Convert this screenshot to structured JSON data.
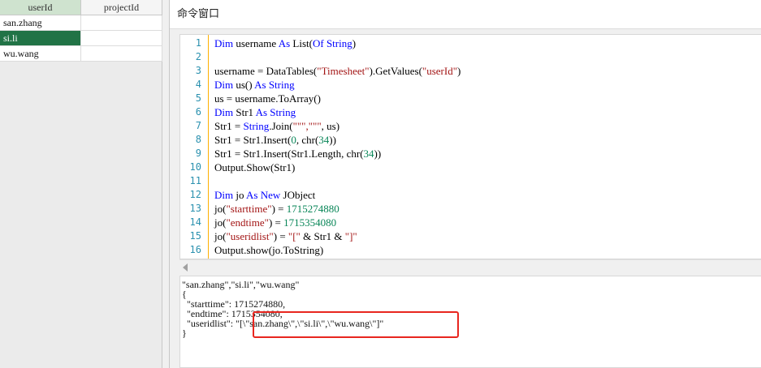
{
  "grid": {
    "columns": [
      "userId",
      "projectId"
    ],
    "rows": [
      {
        "userId": "san.zhang",
        "projectId": ""
      },
      {
        "userId": "si.li",
        "projectId": ""
      },
      {
        "userId": "wu.wang",
        "projectId": ""
      }
    ],
    "selected_header_color": "#cfe3cf",
    "active_cell_color": "#217346"
  },
  "command_window": {
    "title": "命令窗口",
    "line_numbers": [
      "1",
      "2",
      "3",
      "4",
      "5",
      "6",
      "7",
      "8",
      "9",
      "10",
      "11",
      "12",
      "13",
      "14",
      "15",
      "16"
    ],
    "code_lines": [
      [
        {
          "t": "Dim",
          "c": "kw"
        },
        {
          "t": " username "
        },
        {
          "t": "As",
          "c": "kw"
        },
        {
          "t": " List("
        },
        {
          "t": "Of",
          "c": "kw"
        },
        {
          "t": " "
        },
        {
          "t": "String",
          "c": "kw"
        },
        {
          "t": ")"
        }
      ],
      [
        {
          "t": ""
        }
      ],
      [
        {
          "t": "username = DataTables("
        },
        {
          "t": "\"Timesheet\"",
          "c": "str"
        },
        {
          "t": ").GetValues("
        },
        {
          "t": "\"userId\"",
          "c": "str"
        },
        {
          "t": ")"
        }
      ],
      [
        {
          "t": "Dim",
          "c": "kw"
        },
        {
          "t": " us() "
        },
        {
          "t": "As",
          "c": "kw"
        },
        {
          "t": " "
        },
        {
          "t": "String",
          "c": "kw"
        }
      ],
      [
        {
          "t": "us = username.ToArray()"
        }
      ],
      [
        {
          "t": "Dim",
          "c": "kw"
        },
        {
          "t": " Str1 "
        },
        {
          "t": "As",
          "c": "kw"
        },
        {
          "t": " "
        },
        {
          "t": "String",
          "c": "kw"
        }
      ],
      [
        {
          "t": "Str1 = "
        },
        {
          "t": "String",
          "c": "kw"
        },
        {
          "t": ".Join("
        },
        {
          "t": "\"\"\",\"\"\"",
          "c": "str"
        },
        {
          "t": ", us)"
        }
      ],
      [
        {
          "t": "Str1 = Str1.Insert("
        },
        {
          "t": "0",
          "c": "num"
        },
        {
          "t": ", chr("
        },
        {
          "t": "34",
          "c": "num"
        },
        {
          "t": "))"
        }
      ],
      [
        {
          "t": "Str1 = Str1.Insert(Str1.Length, chr("
        },
        {
          "t": "34",
          "c": "num"
        },
        {
          "t": "))"
        }
      ],
      [
        {
          "t": "Output.Show(Str1)"
        }
      ],
      [
        {
          "t": ""
        }
      ],
      [
        {
          "t": "Dim",
          "c": "kw"
        },
        {
          "t": " jo "
        },
        {
          "t": "As",
          "c": "kw"
        },
        {
          "t": " "
        },
        {
          "t": "New",
          "c": "kw"
        },
        {
          "t": " JObject"
        }
      ],
      [
        {
          "t": "jo("
        },
        {
          "t": "\"starttime\"",
          "c": "str"
        },
        {
          "t": ") = "
        },
        {
          "t": "1715274880",
          "c": "num"
        }
      ],
      [
        {
          "t": "jo("
        },
        {
          "t": "\"endtime\"",
          "c": "str"
        },
        {
          "t": ") = "
        },
        {
          "t": "1715354080",
          "c": "num"
        }
      ],
      [
        {
          "t": "jo("
        },
        {
          "t": "\"useridlist\"",
          "c": "str"
        },
        {
          "t": ") = "
        },
        {
          "t": "\"[\"",
          "c": "str"
        },
        {
          "t": " & Str1 & "
        },
        {
          "t": "\"]\"",
          "c": "str"
        }
      ],
      [
        {
          "t": "Output.show(jo.ToString)"
        }
      ]
    ],
    "output_lines": [
      "\"san.zhang\",\"si.li\",\"wu.wang\"",
      "{",
      "  \"starttime\": 1715274880,",
      "  \"endtime\": 1715354080,",
      "  \"useridlist\": \"[\\\"san.zhang\\\",\\\"si.li\\\",\\\"wu.wang\\\"]\"",
      "}"
    ],
    "keyword_color": "#0000ff",
    "string_color": "#a31515",
    "number_color": "#098658",
    "annotation_color": "#e8261f"
  }
}
